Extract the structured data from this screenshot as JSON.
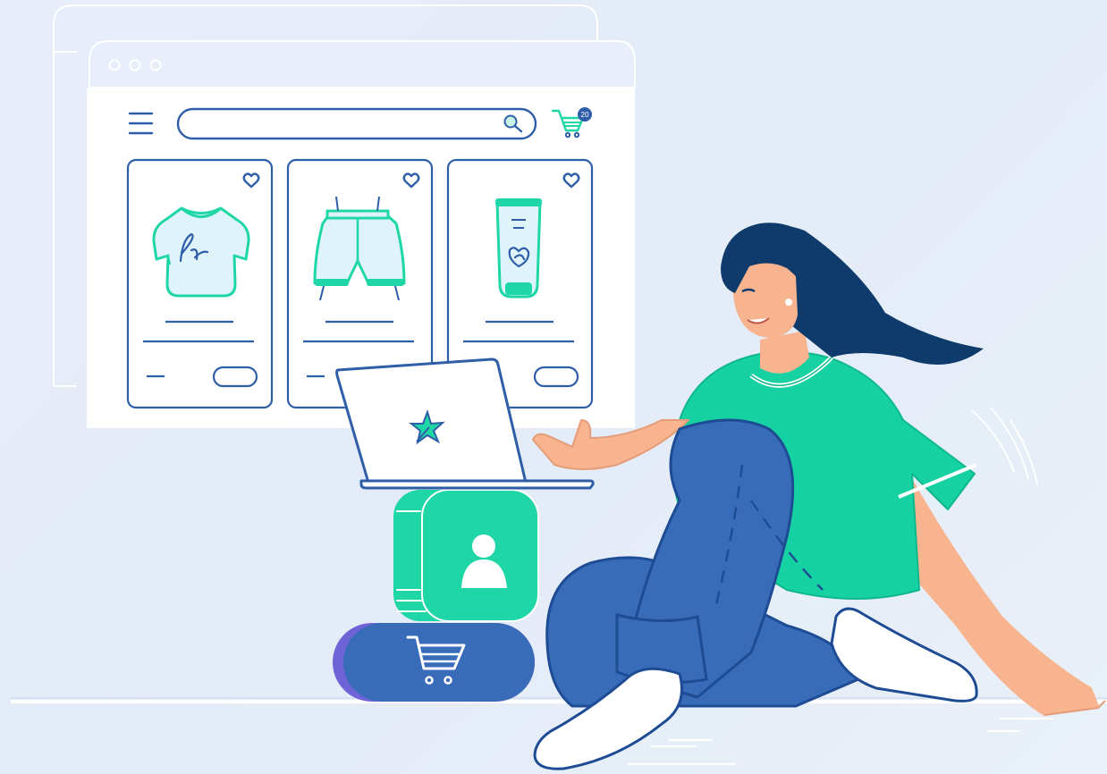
{
  "colors": {
    "background": "#e6edf8",
    "navy": "#2f5ea8",
    "teal": "#1fd6a6",
    "teal_dark": "#00b987",
    "light_blue": "#dff3fb",
    "denim": "#386bb8",
    "hair": "#0f3a6c",
    "skin": "#f7b48f",
    "shirt": "#16d1a1",
    "white": "#ffffff"
  },
  "browser": {
    "window_controls": [
      "close-dot",
      "minimize-dot",
      "maximize-dot"
    ],
    "menu_icon": "hamburger-menu-icon",
    "search": {
      "value": "",
      "icon": "search-icon"
    },
    "cart": {
      "icon": "cart-icon",
      "count": "20"
    }
  },
  "products": [
    {
      "name": "t-shirt",
      "icon": "tshirt-icon",
      "favorite_icon": "heart-icon",
      "action": "add-pill-button"
    },
    {
      "name": "shorts",
      "icon": "shorts-icon",
      "favorite_icon": "heart-icon",
      "action": "add-pill-button"
    },
    {
      "name": "cream-tube",
      "icon": "cream-tube-icon",
      "favorite_icon": "heart-icon",
      "action": "add-pill-button"
    }
  ],
  "props": {
    "laptop_logo_icon": "star-logo-icon",
    "profile_block_icon": "user-icon",
    "cart_block_icon": "cart-icon"
  }
}
